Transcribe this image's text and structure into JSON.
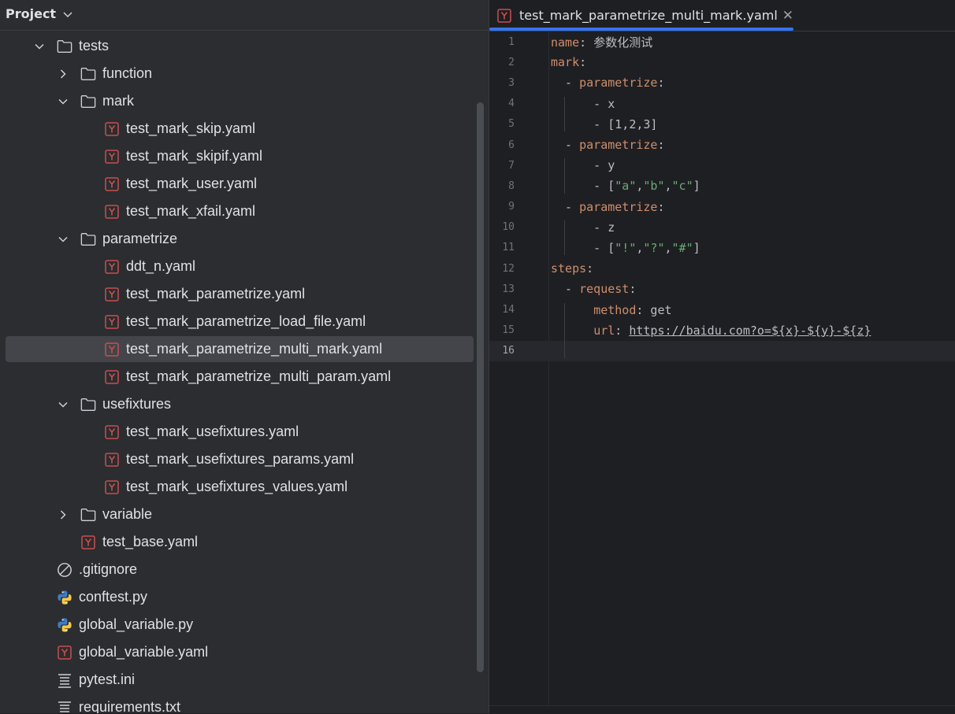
{
  "project_panel": {
    "title": "Project",
    "tree": [
      {
        "label": "tests",
        "type": "folder",
        "depth": 1,
        "arrow": "down"
      },
      {
        "label": "function",
        "type": "folder",
        "depth": 2,
        "arrow": "right"
      },
      {
        "label": "mark",
        "type": "folder",
        "depth": 2,
        "arrow": "down"
      },
      {
        "label": "test_mark_skip.yaml",
        "type": "yaml",
        "depth": 3
      },
      {
        "label": "test_mark_skipif.yaml",
        "type": "yaml",
        "depth": 3
      },
      {
        "label": "test_mark_user.yaml",
        "type": "yaml",
        "depth": 3
      },
      {
        "label": "test_mark_xfail.yaml",
        "type": "yaml",
        "depth": 3
      },
      {
        "label": "parametrize",
        "type": "folder",
        "depth": 2,
        "arrow": "down"
      },
      {
        "label": "ddt_n.yaml",
        "type": "yaml",
        "depth": 3
      },
      {
        "label": "test_mark_parametrize.yaml",
        "type": "yaml",
        "depth": 3
      },
      {
        "label": "test_mark_parametrize_load_file.yaml",
        "type": "yaml",
        "depth": 3
      },
      {
        "label": "test_mark_parametrize_multi_mark.yaml",
        "type": "yaml",
        "depth": 3,
        "selected": true
      },
      {
        "label": "test_mark_parametrize_multi_param.yaml",
        "type": "yaml",
        "depth": 3
      },
      {
        "label": "usefixtures",
        "type": "folder",
        "depth": 2,
        "arrow": "down"
      },
      {
        "label": "test_mark_usefixtures.yaml",
        "type": "yaml",
        "depth": 3
      },
      {
        "label": "test_mark_usefixtures_params.yaml",
        "type": "yaml",
        "depth": 3
      },
      {
        "label": "test_mark_usefixtures_values.yaml",
        "type": "yaml",
        "depth": 3
      },
      {
        "label": "variable",
        "type": "folder",
        "depth": 2,
        "arrow": "right"
      },
      {
        "label": "test_base.yaml",
        "type": "yaml",
        "depth": 2
      },
      {
        "label": ".gitignore",
        "type": "ignore",
        "depth": 1
      },
      {
        "label": "conftest.py",
        "type": "python",
        "depth": 1
      },
      {
        "label": "global_variable.py",
        "type": "python",
        "depth": 1
      },
      {
        "label": "global_variable.yaml",
        "type": "yaml",
        "depth": 1
      },
      {
        "label": "pytest.ini",
        "type": "text",
        "depth": 1
      },
      {
        "label": "requirements.txt",
        "type": "text",
        "depth": 1
      }
    ]
  },
  "editor": {
    "tab": {
      "label": "test_mark_parametrize_multi_mark.yaml",
      "close": "✕"
    },
    "current_line": 16,
    "lines": [
      {
        "n": "1",
        "tokens": [
          {
            "t": "name",
            "c": "k"
          },
          {
            "t": ": ",
            "c": "p"
          },
          {
            "t": "参数化测试",
            "c": "v"
          }
        ]
      },
      {
        "n": "2",
        "tokens": [
          {
            "t": "mark",
            "c": "k"
          },
          {
            "t": ":",
            "c": "p"
          }
        ]
      },
      {
        "n": "3",
        "tokens": [
          {
            "t": "  - ",
            "c": "p"
          },
          {
            "t": "parametrize",
            "c": "k"
          },
          {
            "t": ":",
            "c": "p"
          }
        ]
      },
      {
        "n": "4",
        "tokens": [
          {
            "t": "      - x",
            "c": "v"
          }
        ]
      },
      {
        "n": "5",
        "tokens": [
          {
            "t": "      - [1,2,3]",
            "c": "v"
          }
        ]
      },
      {
        "n": "6",
        "tokens": [
          {
            "t": "  - ",
            "c": "p"
          },
          {
            "t": "parametrize",
            "c": "k"
          },
          {
            "t": ":",
            "c": "p"
          }
        ]
      },
      {
        "n": "7",
        "tokens": [
          {
            "t": "      - y",
            "c": "v"
          }
        ]
      },
      {
        "n": "8",
        "tokens": [
          {
            "t": "      - [",
            "c": "v"
          },
          {
            "t": "\"a\"",
            "c": "s"
          },
          {
            "t": ",",
            "c": "v"
          },
          {
            "t": "\"b\"",
            "c": "s"
          },
          {
            "t": ",",
            "c": "v"
          },
          {
            "t": "\"c\"",
            "c": "s"
          },
          {
            "t": "]",
            "c": "v"
          }
        ]
      },
      {
        "n": "9",
        "tokens": [
          {
            "t": "  - ",
            "c": "p"
          },
          {
            "t": "parametrize",
            "c": "k"
          },
          {
            "t": ":",
            "c": "p"
          }
        ]
      },
      {
        "n": "10",
        "tokens": [
          {
            "t": "      - z",
            "c": "v"
          }
        ]
      },
      {
        "n": "11",
        "tokens": [
          {
            "t": "      - [",
            "c": "v"
          },
          {
            "t": "\"!\"",
            "c": "s"
          },
          {
            "t": ",",
            "c": "v"
          },
          {
            "t": "\"?\"",
            "c": "s"
          },
          {
            "t": ",",
            "c": "v"
          },
          {
            "t": "\"#\"",
            "c": "s"
          },
          {
            "t": "]",
            "c": "v"
          }
        ]
      },
      {
        "n": "12",
        "tokens": [
          {
            "t": "steps",
            "c": "k"
          },
          {
            "t": ":",
            "c": "p"
          }
        ]
      },
      {
        "n": "13",
        "tokens": [
          {
            "t": "  - ",
            "c": "p"
          },
          {
            "t": "request",
            "c": "k"
          },
          {
            "t": ":",
            "c": "p"
          }
        ]
      },
      {
        "n": "14",
        "tokens": [
          {
            "t": "      ",
            "c": "p"
          },
          {
            "t": "method",
            "c": "k"
          },
          {
            "t": ": get",
            "c": "v"
          }
        ]
      },
      {
        "n": "15",
        "tokens": [
          {
            "t": "      ",
            "c": "p"
          },
          {
            "t": "url",
            "c": "k"
          },
          {
            "t": ": ",
            "c": "p"
          },
          {
            "t": "https://baidu.com?o=${x}-${y}-${z}",
            "c": "u"
          }
        ]
      },
      {
        "n": "16",
        "tokens": []
      }
    ]
  },
  "colors": {
    "yaml_icon": "#c94f4f",
    "folder_icon": "#ced0d6",
    "python_blue": "#3f7cc2",
    "python_yellow": "#f5c945",
    "accent": "#3574f0"
  }
}
